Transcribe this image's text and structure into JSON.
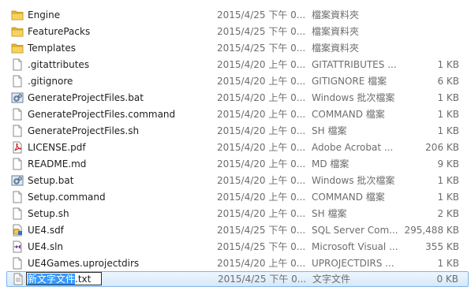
{
  "files": [
    {
      "name": "Engine",
      "date": "2015/4/25 下午 0...",
      "type": "檔案資料夾",
      "size": "",
      "icon": "folder-icon"
    },
    {
      "name": "FeaturePacks",
      "date": "2015/4/25 下午 0...",
      "type": "檔案資料夾",
      "size": "",
      "icon": "folder-icon"
    },
    {
      "name": "Templates",
      "date": "2015/4/25 下午 0...",
      "type": "檔案資料夾",
      "size": "",
      "icon": "folder-icon"
    },
    {
      "name": ".gitattributes",
      "date": "2015/4/20 上午 0...",
      "type": "GITATTRIBUTES ...",
      "size": "1 KB",
      "icon": "document-icon"
    },
    {
      "name": ".gitignore",
      "date": "2015/4/20 上午 0...",
      "type": "GITIGNORE 檔案",
      "size": "6 KB",
      "icon": "document-icon"
    },
    {
      "name": "GenerateProjectFiles.bat",
      "date": "2015/4/20 上午 0...",
      "type": "Windows 批次檔案",
      "size": "1 KB",
      "icon": "batch-file-icon"
    },
    {
      "name": "GenerateProjectFiles.command",
      "date": "2015/4/20 上午 0...",
      "type": "COMMAND 檔案",
      "size": "1 KB",
      "icon": "document-icon"
    },
    {
      "name": "GenerateProjectFiles.sh",
      "date": "2015/4/20 上午 0...",
      "type": "SH 檔案",
      "size": "1 KB",
      "icon": "document-icon"
    },
    {
      "name": "LICENSE.pdf",
      "date": "2015/4/20 上午 0...",
      "type": "Adobe Acrobat ...",
      "size": "206 KB",
      "icon": "pdf-icon"
    },
    {
      "name": "README.md",
      "date": "2015/4/20 上午 0...",
      "type": "MD 檔案",
      "size": "9 KB",
      "icon": "document-icon"
    },
    {
      "name": "Setup.bat",
      "date": "2015/4/20 上午 0...",
      "type": "Windows 批次檔案",
      "size": "1 KB",
      "icon": "batch-file-icon"
    },
    {
      "name": "Setup.command",
      "date": "2015/4/20 上午 0...",
      "type": "COMMAND 檔案",
      "size": "1 KB",
      "icon": "document-icon"
    },
    {
      "name": "Setup.sh",
      "date": "2015/4/20 上午 0...",
      "type": "SH 檔案",
      "size": "2 KB",
      "icon": "document-icon"
    },
    {
      "name": "UE4.sdf",
      "date": "2015/4/25 下午 0...",
      "type": "SQL Server Com...",
      "size": "295,488 KB",
      "icon": "database-file-icon"
    },
    {
      "name": "UE4.sln",
      "date": "2015/4/25 下午 0...",
      "type": "Microsoft Visual ...",
      "size": "355 KB",
      "icon": "visual-studio-solution-icon"
    },
    {
      "name": "UE4Games.uprojectdirs",
      "date": "2015/4/20 上午 0...",
      "type": "UPROJECTDIRS ...",
      "size": "1 KB",
      "icon": "document-icon"
    }
  ],
  "renaming": {
    "name_selected": "新文字文件",
    "extension": ".txt",
    "date": "2015/4/25 下午 0...",
    "type": "文字文件",
    "size": "0 KB",
    "icon": "text-file-icon"
  }
}
